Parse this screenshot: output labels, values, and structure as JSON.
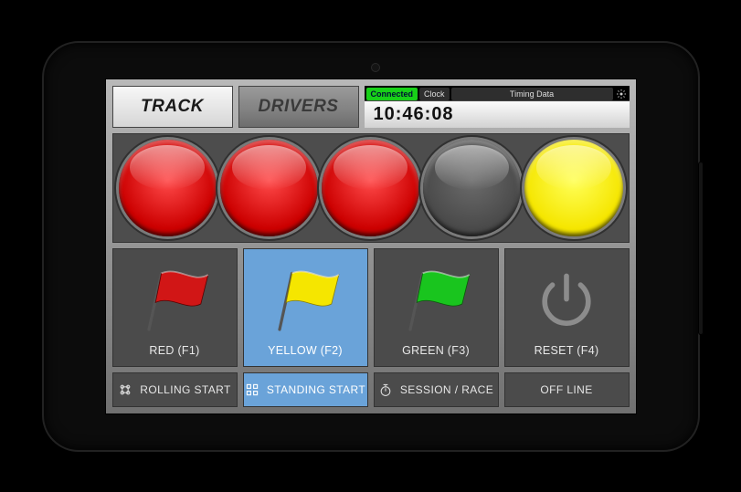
{
  "tabs": {
    "track": "TRACK",
    "drivers": "DRIVERS",
    "active": "track"
  },
  "status": {
    "connected_label": "Connected",
    "clock_label": "Clock",
    "timing_label": "Timing Data"
  },
  "clock": "10:46:08",
  "lights": [
    {
      "color": "red"
    },
    {
      "color": "red"
    },
    {
      "color": "red"
    },
    {
      "color": "off"
    },
    {
      "color": "yellow"
    }
  ],
  "flags": {
    "red": {
      "label": "RED (F1)",
      "selected": false
    },
    "yellow": {
      "label": "YELLOW (F2)",
      "selected": true
    },
    "green": {
      "label": "GREEN (F3)",
      "selected": false
    },
    "reset": {
      "label": "RESET (F4)",
      "selected": false
    }
  },
  "bottom": {
    "rolling": {
      "label": "ROLLING START",
      "selected": false
    },
    "standing": {
      "label": "STANDING START",
      "selected": true
    },
    "session": {
      "label": "SESSION / RACE",
      "selected": false
    },
    "offline": {
      "label": "OFF LINE",
      "selected": false
    }
  },
  "colors": {
    "flag_red": "#d11616",
    "flag_yellow": "#f5e600",
    "flag_green": "#19c51e"
  }
}
